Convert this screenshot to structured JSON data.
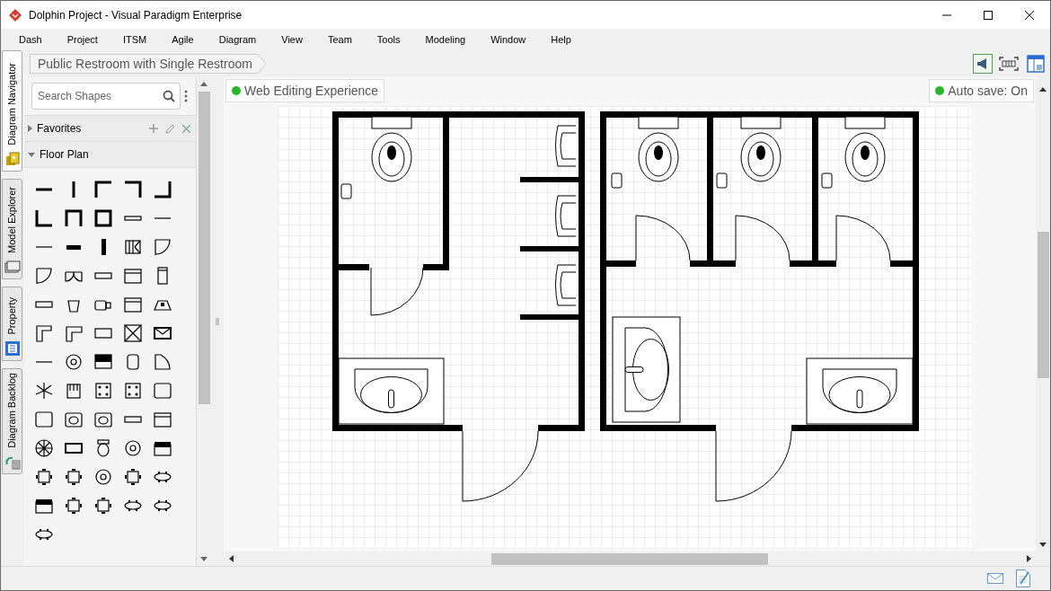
{
  "window": {
    "title": "Dolphin Project - Visual Paradigm Enterprise"
  },
  "menu": [
    "Dash",
    "Project",
    "ITSM",
    "Agile",
    "Diagram",
    "View",
    "Team",
    "Tools",
    "Modeling",
    "Window",
    "Help"
  ],
  "breadcrumb": "Public Restroom with Single Restroom",
  "side_tabs": [
    {
      "label": "Diagram Navigator",
      "selected": true
    },
    {
      "label": "Model Explorer",
      "selected": false
    },
    {
      "label": "Property",
      "selected": false
    },
    {
      "label": "Diagram Backlog",
      "selected": false
    }
  ],
  "shapes_panel": {
    "search": {
      "placeholder": "Search Shapes"
    },
    "groups": [
      {
        "label": "Favorites",
        "kind": "favorites",
        "expanded": false
      },
      {
        "label": "Floor Plan",
        "kind": "library",
        "expanded": true
      }
    ]
  },
  "canvas": {
    "badges": [
      "Web Editing Experience",
      "Auto save: On"
    ]
  }
}
